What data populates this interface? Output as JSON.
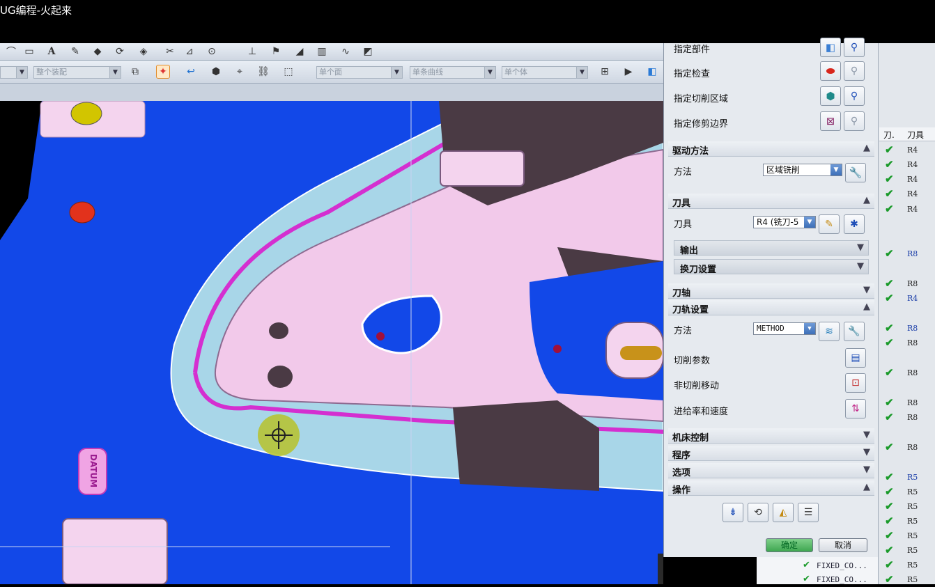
{
  "window": {
    "title": "UG编程-火起来"
  },
  "toolbar": {
    "filter_select": "整个装配",
    "face_select": "单个面",
    "curve_select": "单条曲线",
    "body_select": "单个体"
  },
  "dialog": {
    "geometry_rows": [
      {
        "label": "指定部件"
      },
      {
        "label": "指定检查"
      },
      {
        "label": "指定切削区域"
      },
      {
        "label": "指定修剪边界"
      }
    ],
    "drive_method": {
      "title": "驱动方法",
      "method_label": "方法",
      "method_value": "区域铣削"
    },
    "tool": {
      "title": "刀具",
      "tool_label": "刀具",
      "tool_value": "R4 (铣刀-5",
      "output_label": "输出",
      "tool_change_label": "换刀设置"
    },
    "tool_axis": {
      "title": "刀轴"
    },
    "path_settings": {
      "title": "刀轨设置",
      "method_label": "方法",
      "method_value": "METHOD",
      "cut_params_label": "切削参数",
      "non_cut_moves_label": "非切削移动",
      "feeds_speeds_label": "进给率和速度"
    },
    "machine_control": {
      "title": "机床控制"
    },
    "program": {
      "title": "程序"
    },
    "options": {
      "title": "选项"
    },
    "actions": {
      "title": "操作"
    },
    "ok_label": "确定",
    "cancel_label": "取消"
  },
  "navigator": {
    "headers": [
      "刀.",
      "刀具"
    ],
    "rows": [
      {
        "check": "✔",
        "tool": "R4",
        "blue": false
      },
      {
        "check": "✔",
        "tool": "R4",
        "blue": false
      },
      {
        "check": "✔",
        "tool": "R4",
        "blue": false
      },
      {
        "check": "✔",
        "tool": "R4",
        "blue": false
      },
      {
        "check": "✔",
        "tool": "R4",
        "blue": false
      },
      {
        "check": "✔",
        "tool": "R8",
        "blue": true
      },
      {
        "check": "✔",
        "tool": "R8",
        "blue": false
      },
      {
        "check": "✔",
        "tool": "R4",
        "blue": true
      },
      {
        "check": "✔",
        "tool": "R8",
        "blue": true
      },
      {
        "check": "✔",
        "tool": "R8",
        "blue": false
      },
      {
        "check": "✔",
        "tool": "R8",
        "blue": false
      },
      {
        "check": "✔",
        "tool": "R8",
        "blue": false
      },
      {
        "check": "✔",
        "tool": "R8",
        "blue": false
      },
      {
        "check": "✔",
        "tool": "R8",
        "blue": false
      },
      {
        "check": "✔",
        "tool": "R5",
        "blue": true
      },
      {
        "check": "✔",
        "tool": "R5",
        "blue": false
      },
      {
        "check": "✔",
        "tool": "R5",
        "blue": false
      },
      {
        "check": "✔",
        "tool": "R5",
        "blue": false
      },
      {
        "check": "✔",
        "tool": "R5",
        "blue": false
      },
      {
        "check": "✔",
        "tool": "R5",
        "blue": false
      },
      {
        "check": "✔",
        "tool": "R5",
        "blue": false
      },
      {
        "check": "✔",
        "tool": "R5",
        "blue": false
      }
    ],
    "op_rows": [
      "FIXED_CO...",
      "FIXED_CO..."
    ]
  },
  "viewport": {
    "datum_label": "DATUM"
  },
  "colors": {
    "viewport_blue": "#1248e8",
    "part_pink": "#f2c9ea",
    "magenta": "#d42fd0",
    "ok_green": "#3ea650"
  }
}
